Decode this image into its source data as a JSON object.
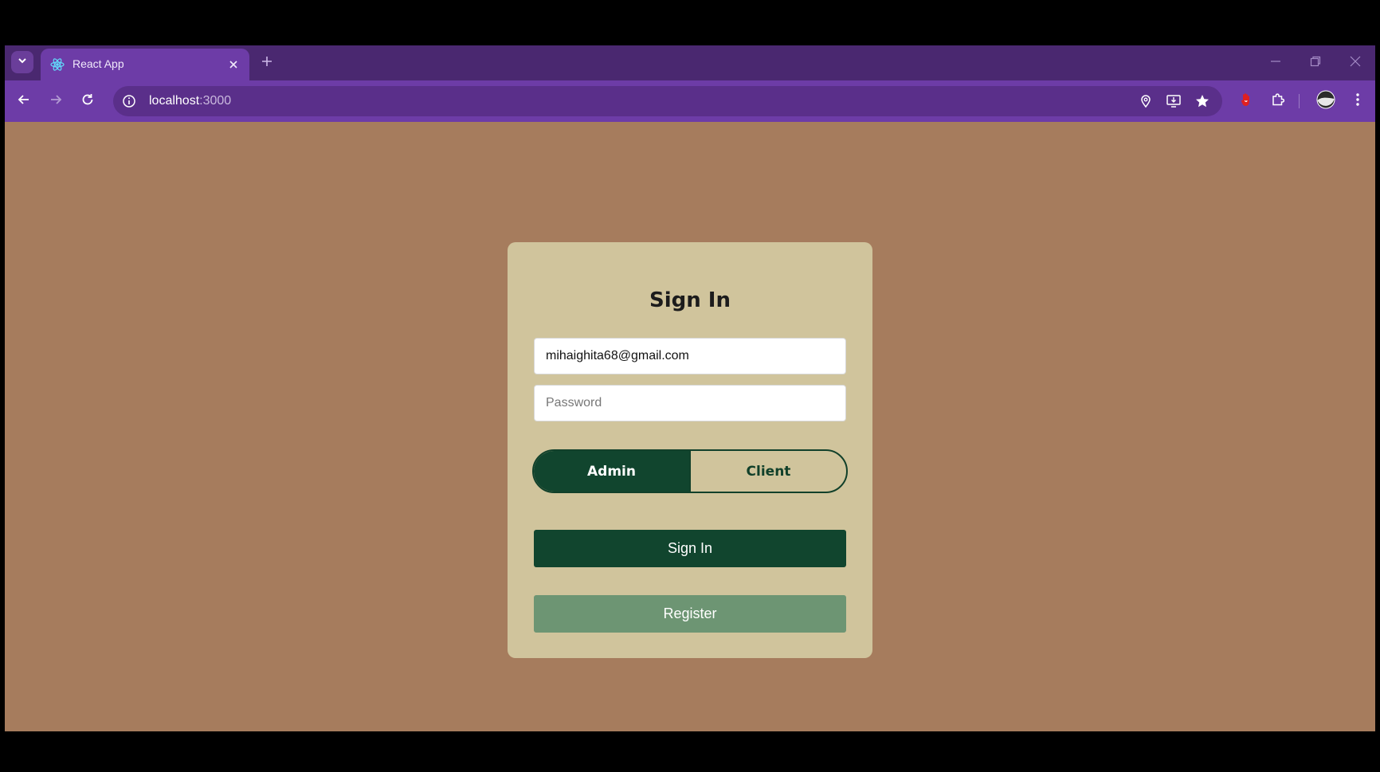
{
  "browser": {
    "tab": {
      "title": "React App"
    },
    "address_bar": {
      "host": "localhost",
      "port": ":3000"
    }
  },
  "login": {
    "title": "Sign In",
    "email_value": "mihaighita68@gmail.com",
    "password_placeholder": "Password",
    "roles": [
      "Admin",
      "Client"
    ],
    "selected_role": "Admin",
    "signin_label": "Sign In",
    "register_label": "Register"
  },
  "colors": {
    "page_bg": "#a67c5d",
    "card_bg": "#d0c49c",
    "primary_green": "#11452e",
    "register_green": "#6d9573",
    "browser_purple": "#6d3ca7"
  },
  "icons": {
    "tab_search": "chevron-down-icon",
    "favicon": "react-icon",
    "close_tab": "close-icon",
    "new_tab": "plus-icon",
    "back": "arrow-left-icon",
    "forward": "arrow-right-icon",
    "reload": "reload-icon",
    "site_info": "info-icon",
    "location": "location-pin-icon",
    "install": "install-app-icon",
    "bookmark": "star-icon",
    "extension_red": "red-hand-icon",
    "extensions": "puzzle-icon",
    "profile": "avatar",
    "menu": "kebab-menu-icon",
    "minimize": "minimize-icon",
    "restore": "restore-icon",
    "close_window": "close-window-icon"
  }
}
